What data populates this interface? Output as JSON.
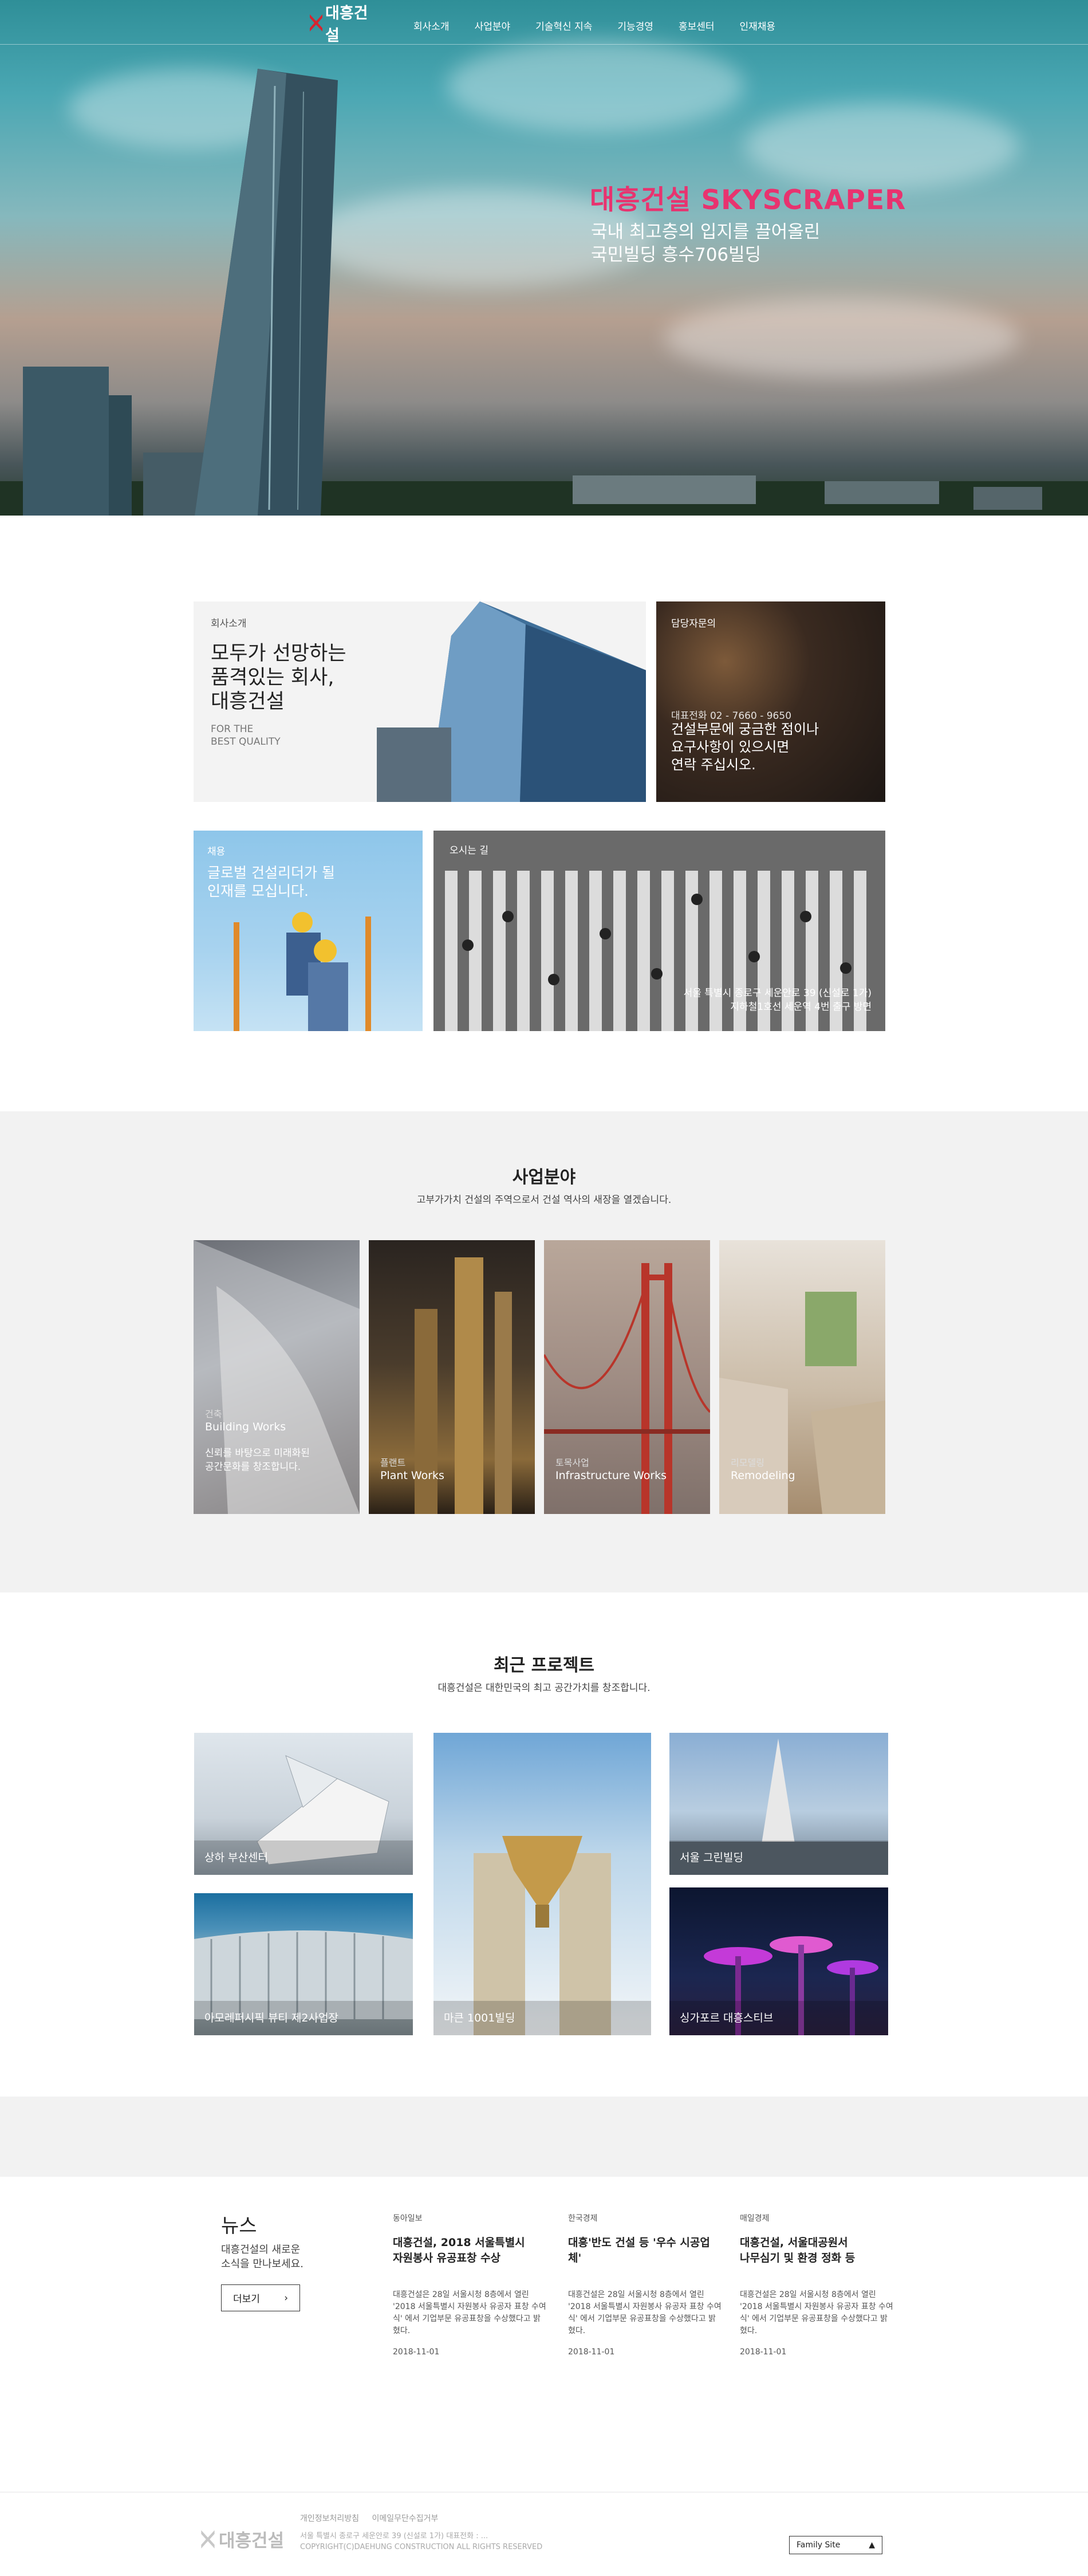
{
  "header": {
    "logo_text": "대흥건설",
    "menu": [
      "회사소개",
      "사업분야",
      "기술혁신 지속",
      "기능경영",
      "홍보센터",
      "인재채용"
    ]
  },
  "hero": {
    "title": "대흥건설 SKYSCRAPER",
    "subtitle": "국내 최고층의 입지를 끌어올린\n국민빌딩 흥수706빌딩"
  },
  "intro": {
    "label": "회사소개",
    "heading": "모두가 선망하는\n품격있는 회사,\n대흥건설",
    "tagline": "FOR THE\nBEST QUALITY"
  },
  "contact": {
    "label": "담당자문의",
    "phone": "대표전화 02 - 7660 - 9650",
    "message": "건설부문에 궁금한 점이나\n요구사항이 있으시면\n연락 주십시오."
  },
  "recruit": {
    "label": "채용",
    "message": "글로벌 건설리더가 될\n인재를 모십니다."
  },
  "location": {
    "label": "오시는 길",
    "address": "서울 특별시 종로구 세운안로 39 (신설로 1가)\n지하철1호선 세운역 4번 출구 방면"
  },
  "business": {
    "title": "사업분야",
    "subtitle": "고부가가치 건설의 주역으로서 건설 역사의 새장을 열겠습니다.",
    "items": [
      {
        "kr": "건축",
        "en": "Building Works",
        "desc": "신뢰를 바탕으로 미래화된\n공간문화를 창조합니다."
      },
      {
        "kr": "플랜트",
        "en": "Plant Works",
        "desc": ""
      },
      {
        "kr": "토목사업",
        "en": "Infrastructure Works",
        "desc": ""
      },
      {
        "kr": "리모델링",
        "en": "Remodeling",
        "desc": ""
      }
    ]
  },
  "projects": {
    "title": "최근 프로젝트",
    "subtitle": "대흥건설은 대한민국의 최고 공간가치를 창조합니다.",
    "items": [
      {
        "name": "상하 부산센터"
      },
      {
        "name": "아모레퍼시픽 뷰티 제2사업장"
      },
      {
        "name": "마큰 1001빌딩"
      },
      {
        "name": "서울 그린빌딩"
      },
      {
        "name": "싱가포르 대흥스티브"
      }
    ]
  },
  "news": {
    "title": "뉴스",
    "desc": "대흥건설의 새로운\n소식을 만나보세요.",
    "more": "더보기",
    "items": [
      {
        "source": "동아일보",
        "headline": "대흥건설, 2018 서울특별시\n자원봉사 유공표창 수상",
        "body": "대흥건설은 28일 서울시청 8층에서 열린 '2018 서울특별시 자원봉사 유공자 표창 수여식' 에서 기업부문 유공표창을 수상했다고 밝혔다.",
        "date": "2018-11-01"
      },
      {
        "source": "한국경제",
        "headline": "대흥'반도 건설 등 '우수 시공업체'",
        "body": "대흥건설은 28일 서울시청 8층에서 열린 '2018 서울특별시 자원봉사 유공자 표창 수여식' 에서 기업부문 유공표창을 수상했다고 밝혔다.",
        "date": "2018-11-01"
      },
      {
        "source": "매일경제",
        "headline": "대흥건설, 서울대공원서\n나무심기 및 환경 정화 등",
        "body": "대흥건설은 28일 서울시청 8층에서 열린 '2018 서울특별시 자원봉사 유공자 표창 수여식' 에서 기업부문 유공표창을 수상했다고 밝혔다.",
        "date": "2018-11-01"
      }
    ]
  },
  "footer": {
    "logo_text": "대흥건설",
    "links": [
      "개인정보처리방침",
      "이메일무단수집거부"
    ],
    "address": "서울 특별시 종로구 세운안로 39 (신설로 1가) 대표전화 : ...\nCOPYRIGHT(C)DAEHUNG CONSTRUCTION ALL RIGHTS RESERVED",
    "family_site": "Family Site"
  },
  "colors": {
    "accent": "#e8336f",
    "logo_red": "#d7242f"
  }
}
